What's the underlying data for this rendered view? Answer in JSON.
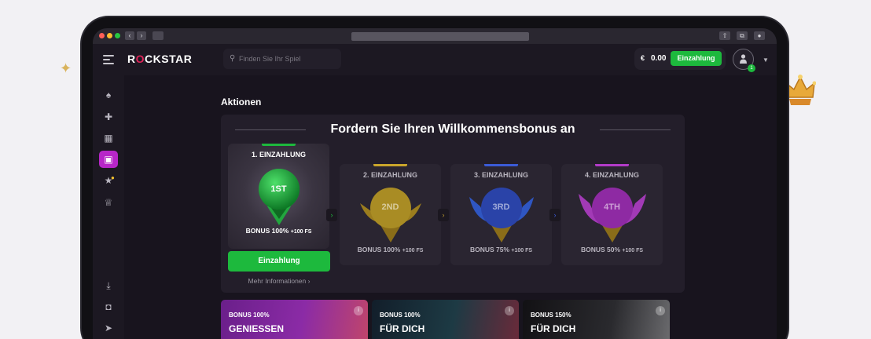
{
  "header": {
    "logo": {
      "pre": "R",
      "o": "O",
      "post": "CKSTAR"
    },
    "search_placeholder": "Finden Sie Ihr Spiel",
    "wallet": {
      "currency": "€",
      "balance": "0.00",
      "deposit_label": "Einzahlung"
    },
    "notification_count": "1"
  },
  "page": {
    "title": "Aktionen",
    "welcome_title": "Fordern Sie Ihren Willkommensbonus an"
  },
  "steps": [
    {
      "label": "1. EINZAHLUNG",
      "medal": "1ST",
      "bonus": "BONUS 100%",
      "fs": "+100 FS",
      "color": "#1db93d"
    },
    {
      "label": "2. EINZAHLUNG",
      "medal": "2ND",
      "bonus": "BONUS 100%",
      "fs": "+100 FS",
      "color": "#c9a52b"
    },
    {
      "label": "3. EINZAHLUNG",
      "medal": "3RD",
      "bonus": "BONUS 75%",
      "fs": "+100 FS",
      "color": "#3b5bd6"
    },
    {
      "label": "4. EINZAHLUNG",
      "medal": "4TH",
      "bonus": "BONUS 50%",
      "fs": "+100 FS",
      "color": "#b23bc8"
    }
  ],
  "cta": {
    "deposit_label": "Einzahlung",
    "more_info": "Mehr Informationen"
  },
  "cards": [
    {
      "line1": "BONUS 100%",
      "line2": "GENIESSEN"
    },
    {
      "line1": "BONUS 100%",
      "line2": "FÜR DICH"
    },
    {
      "line1": "BONUS 150%",
      "line2": "FÜR DICH"
    }
  ],
  "icons": {
    "sidebar": [
      "spade-icon",
      "puzzle-icon",
      "grid-icon",
      "gift-icon",
      "star-lock-icon",
      "trophy-icon",
      "download-icon",
      "instagram-icon",
      "telegram-icon"
    ]
  }
}
